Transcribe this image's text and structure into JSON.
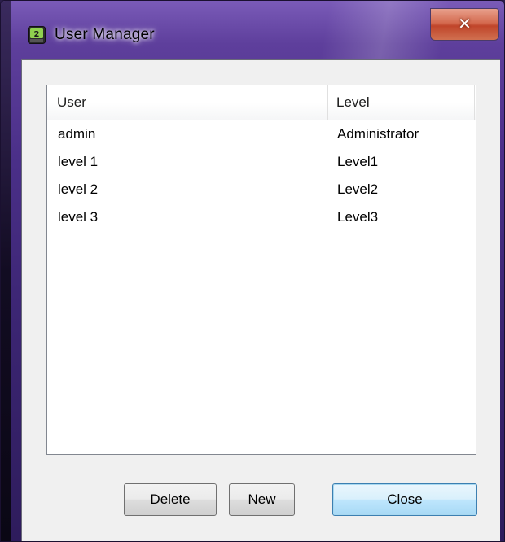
{
  "window": {
    "title": "User Manager",
    "app_icon": "app-icon",
    "close_glyph": "✕"
  },
  "list": {
    "columns": [
      "User",
      "Level"
    ],
    "rows": [
      {
        "user": "admin",
        "level": "Administrator"
      },
      {
        "user": "level 1",
        "level": "Level1"
      },
      {
        "user": "level 2",
        "level": "Level2"
      },
      {
        "user": "level 3",
        "level": "Level3"
      }
    ]
  },
  "buttons": {
    "delete": "Delete",
    "new": "New",
    "close": "Close"
  },
  "colors": {
    "frame": "#4a2f88",
    "client_bg": "#f0f0f0",
    "default_button_border": "#3c7fb1"
  }
}
